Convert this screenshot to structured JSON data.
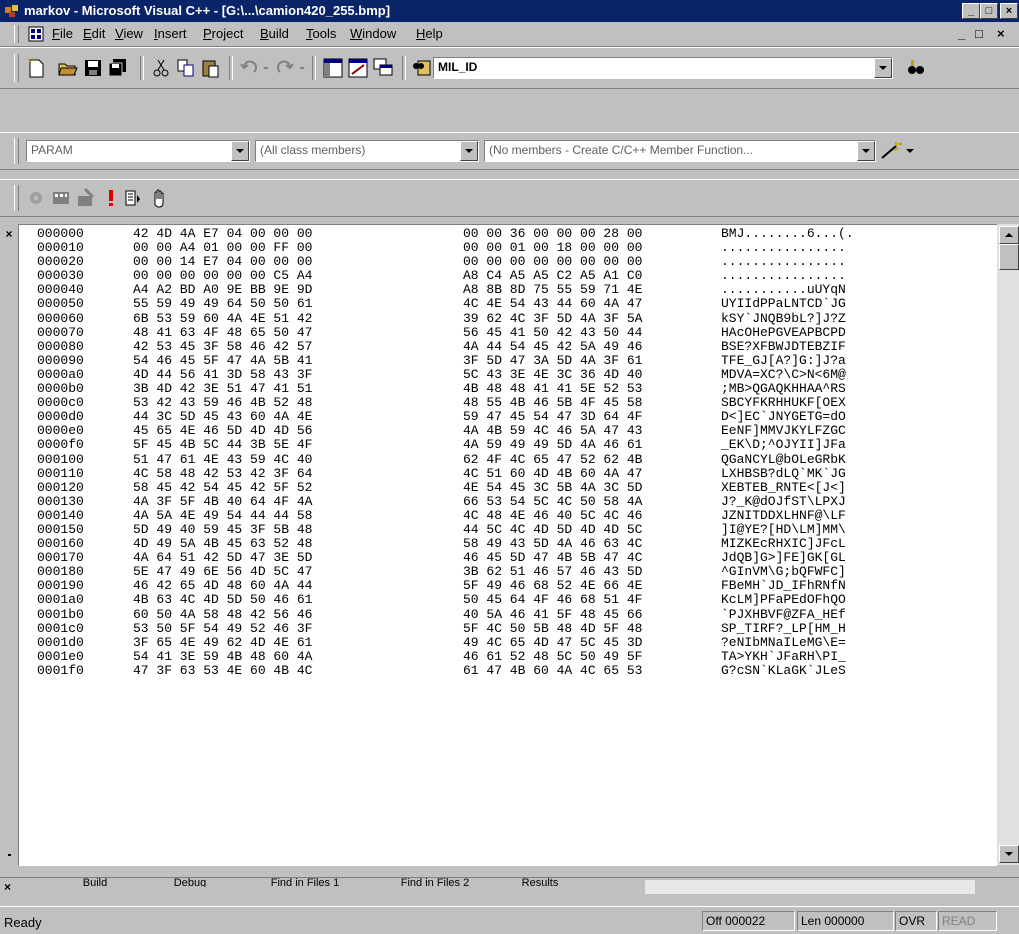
{
  "window": {
    "title": "markov - Microsoft Visual C++ - [G:\\...\\camion420_255.bmp]",
    "minimize_glyph": "_",
    "restore_glyph": "□",
    "close_glyph": "×",
    "title_bar_color": "#0a246a"
  },
  "menu": {
    "items": [
      "File",
      "Edit",
      "View",
      "Insert",
      "Project",
      "Build",
      "Tools",
      "Window",
      "Help"
    ],
    "mdi_min": "_",
    "mdi_restore": "□",
    "mdi_close": "×"
  },
  "toolbar": {
    "find_combo_value": "MIL_ID",
    "icons": [
      "new-text-file-icon",
      "open-icon",
      "save-icon",
      "save-all-icon",
      "cut-icon",
      "copy-icon",
      "paste-icon",
      "undo-icon",
      "redo-icon",
      "workspace-icon",
      "output-icon",
      "window-list-icon",
      "find-in-files-icon",
      "find-icon"
    ]
  },
  "wizardbar": {
    "class_combo": "PARAM",
    "filter_combo": "(All class members)",
    "members_combo": "(No members - Create C/C++ Member Function..."
  },
  "buildbar": {
    "icons": [
      "compile-icon",
      "build-icon",
      "build-stop-icon",
      "execute-icon",
      "go-icon",
      "breakpoint-icon"
    ]
  },
  "hex": {
    "rows": [
      {
        "off": "000000",
        "b1": "42 4D 4A E7 04 00 00 00",
        "b2": "00 00 36 00 00 00 28 00",
        "asc": "BMJ........6...(."
      },
      {
        "off": "000010",
        "b1": "00 00 A4 01 00 00 FF 00",
        "b2": "00 00 01 00 18 00 00 00",
        "asc": "................"
      },
      {
        "off": "000020",
        "b1": "00 00 14 E7 04 00 00 00",
        "b2": "00 00 00 00 00 00 00 00",
        "asc": "................"
      },
      {
        "off": "000030",
        "b1": "00 00 00 00 00 00 C5 A4",
        "b2": "A8 C4 A5 A5 C2 A5 A1 C0",
        "asc": "................"
      },
      {
        "off": "000040",
        "b1": "A4 A2 BD A0 9E BB 9E 9D",
        "b2": "A8 8B 8D 75 55 59 71 4E",
        "asc": "...........uUYqN"
      },
      {
        "off": "000050",
        "b1": "55 59 49 49 64 50 50 61",
        "b2": "4C 4E 54 43 44 60 4A 47",
        "asc": "UYIIdPPaLNTCD`JG"
      },
      {
        "off": "000060",
        "b1": "6B 53 59 60 4A 4E 51 42",
        "b2": "39 62 4C 3F 5D 4A 3F 5A",
        "asc": "kSY`JNQB9bL?]J?Z"
      },
      {
        "off": "000070",
        "b1": "48 41 63 4F 48 65 50 47",
        "b2": "56 45 41 50 42 43 50 44",
        "asc": "HAcOHePGVEAPBCPD"
      },
      {
        "off": "000080",
        "b1": "42 53 45 3F 58 46 42 57",
        "b2": "4A 44 54 45 42 5A 49 46",
        "asc": "BSE?XFBWJDTEBZIF"
      },
      {
        "off": "000090",
        "b1": "54 46 45 5F 47 4A 5B 41",
        "b2": "3F 5D 47 3A 5D 4A 3F 61",
        "asc": "TFE_GJ[A?]G:]J?a"
      },
      {
        "off": "0000a0",
        "b1": "4D 44 56 41 3D 58 43 3F",
        "b2": "5C 43 3E 4E 3C 36 4D 40",
        "asc": "MDVA=XC?\\C>N<6M@"
      },
      {
        "off": "0000b0",
        "b1": "3B 4D 42 3E 51 47 41 51",
        "b2": "4B 48 48 41 41 5E 52 53",
        "asc": ";MB>QGAQKHHAA^RS"
      },
      {
        "off": "0000c0",
        "b1": "53 42 43 59 46 4B 52 48",
        "b2": "48 55 4B 46 5B 4F 45 58",
        "asc": "SBCYFKRHHUKF[OEX"
      },
      {
        "off": "0000d0",
        "b1": "44 3C 5D 45 43 60 4A 4E",
        "b2": "59 47 45 54 47 3D 64 4F",
        "asc": "D<]EC`JNYGETG=dO"
      },
      {
        "off": "0000e0",
        "b1": "45 65 4E 46 5D 4D 4D 56",
        "b2": "4A 4B 59 4C 46 5A 47 43",
        "asc": "EeNF]MMVJKYLFZGC"
      },
      {
        "off": "0000f0",
        "b1": "5F 45 4B 5C 44 3B 5E 4F",
        "b2": "4A 59 49 49 5D 4A 46 61",
        "asc": "_EK\\D;^OJYII]JFa"
      },
      {
        "off": "000100",
        "b1": "51 47 61 4E 43 59 4C 40",
        "b2": "62 4F 4C 65 47 52 62 4B",
        "asc": "QGaNCYL@bOLeGRbK"
      },
      {
        "off": "000110",
        "b1": "4C 58 48 42 53 42 3F 64",
        "b2": "4C 51 60 4D 4B 60 4A 47",
        "asc": "LXHBSB?dLQ`MK`JG"
      },
      {
        "off": "000120",
        "b1": "58 45 42 54 45 42 5F 52",
        "b2": "4E 54 45 3C 5B 4A 3C 5D",
        "asc": "XEBTEB_RNTE<[J<]"
      },
      {
        "off": "000130",
        "b1": "4A 3F 5F 4B 40 64 4F 4A",
        "b2": "66 53 54 5C 4C 50 58 4A",
        "asc": "J?_K@dOJfST\\LPXJ"
      },
      {
        "off": "000140",
        "b1": "4A 5A 4E 49 54 44 44 58",
        "b2": "4C 48 4E 46 40 5C 4C 46",
        "asc": "JZNITDDXLHNF@\\LF"
      },
      {
        "off": "000150",
        "b1": "5D 49 40 59 45 3F 5B 48",
        "b2": "44 5C 4C 4D 5D 4D 4D 5C",
        "asc": "]I@YE?[HD\\LM]MM\\"
      },
      {
        "off": "000160",
        "b1": "4D 49 5A 4B 45 63 52 48",
        "b2": "58 49 43 5D 4A 46 63 4C",
        "asc": "MIZKEcRHXIC]JFcL"
      },
      {
        "off": "000170",
        "b1": "4A 64 51 42 5D 47 3E 5D",
        "b2": "46 45 5D 47 4B 5B 47 4C",
        "asc": "JdQB]G>]FE]GK[GL"
      },
      {
        "off": "000180",
        "b1": "5E 47 49 6E 56 4D 5C 47",
        "b2": "3B 62 51 46 57 46 43 5D",
        "asc": "^GInVM\\G;bQFWFC]"
      },
      {
        "off": "000190",
        "b1": "46 42 65 4D 48 60 4A 44",
        "b2": "5F 49 46 68 52 4E 66 4E",
        "asc": "FBeMH`JD_IFhRNfN"
      },
      {
        "off": "0001a0",
        "b1": "4B 63 4C 4D 5D 50 46 61",
        "b2": "50 45 64 4F 46 68 51 4F",
        "asc": "KcLM]PFaPEdOFhQO"
      },
      {
        "off": "0001b0",
        "b1": "60 50 4A 58 48 42 56 46",
        "b2": "40 5A 46 41 5F 48 45 66",
        "asc": "`PJXHBVF@ZFA_HEf"
      },
      {
        "off": "0001c0",
        "b1": "53 50 5F 54 49 52 46 3F",
        "b2": "5F 4C 50 5B 48 4D 5F 48",
        "asc": "SP_TIRF?_LP[HM_H"
      },
      {
        "off": "0001d0",
        "b1": "3F 65 4E 49 62 4D 4E 61",
        "b2": "49 4C 65 4D 47 5C 45 3D",
        "asc": "?eNIbMNaILeMG\\E="
      },
      {
        "off": "0001e0",
        "b1": "54 41 3E 59 4B 48 60 4A",
        "b2": "46 61 52 48 5C 50 49 5F",
        "asc": "TA>YKH`JFaRH\\PI_"
      },
      {
        "off": "0001f0",
        "b1": "47 3F 63 53 4E 60 4B 4C",
        "b2": "61 47 4B 60 4A 4C 65 53",
        "asc": "G?cSN`KLaGK`JLeS"
      }
    ]
  },
  "tabs": [
    "Build",
    "Debug",
    "Find in Files 1",
    "Find in Files 2",
    "Results"
  ],
  "status": {
    "text": "Ready",
    "offset": "Off 000022",
    "length": "Len 000000",
    "ovr": "OVR",
    "read": "READ"
  }
}
